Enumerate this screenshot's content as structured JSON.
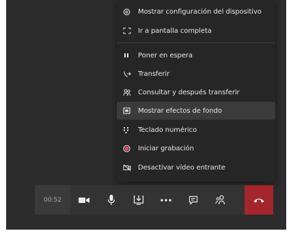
{
  "menu": {
    "items": [
      {
        "label": "Mostrar configuración del dispositivo",
        "icon": "gear-icon"
      },
      {
        "label": "Ir a pantalla completa",
        "icon": "fullscreen-icon"
      },
      {
        "label": "Poner en espera",
        "icon": "pause-icon"
      },
      {
        "label": "Transferir",
        "icon": "transfer-icon"
      },
      {
        "label": "Consultar y después transferir",
        "icon": "consult-transfer-icon"
      },
      {
        "label": "Mostrar efectos de fondo",
        "icon": "background-effects-icon"
      },
      {
        "label": "Teclado numérico",
        "icon": "dialpad-icon"
      },
      {
        "label": "Iniciar grabación",
        "icon": "record-icon"
      },
      {
        "label": "Desactivar vídeo entrante",
        "icon": "video-off-icon"
      }
    ],
    "active_item": "Mostrar efectos de fondo"
  },
  "toolbar": {
    "timer": "00:52",
    "buttons": [
      "camera-icon",
      "microphone-icon",
      "share-screen-icon",
      "more-options-icon",
      "chat-icon",
      "participants-icon",
      "hang-up-icon"
    ]
  },
  "colors": {
    "menu_bg": "#262626",
    "toolbar_bg": "#333333",
    "hangup": "#a4262c",
    "record": "#e8495a"
  }
}
